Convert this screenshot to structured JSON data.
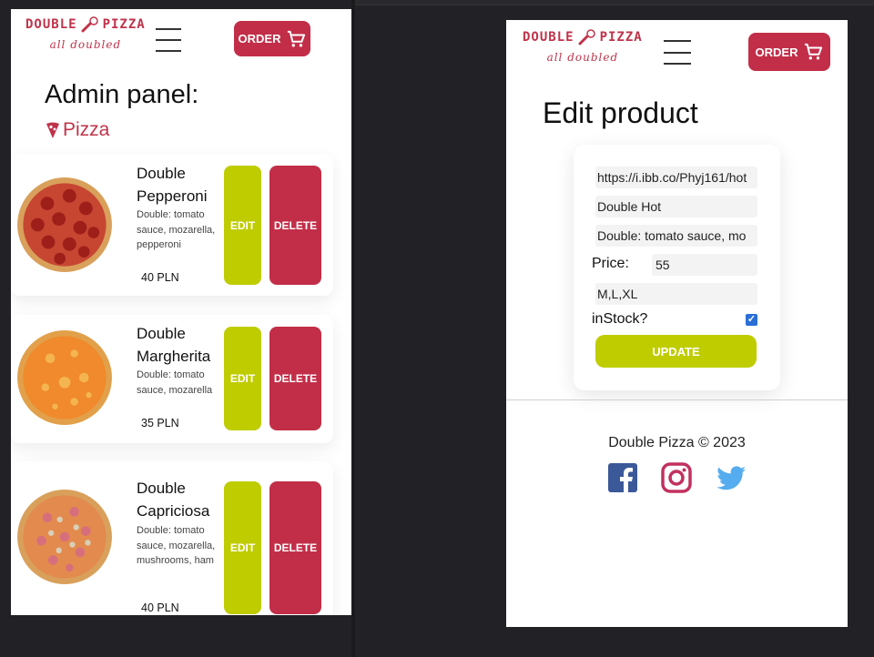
{
  "brand": {
    "name_left": "DOUBLE",
    "name_right": "PIZZA",
    "tagline": "all doubled",
    "accent": "#c0334a",
    "lime": "#bfcc00"
  },
  "header": {
    "order_label": "ORDER",
    "cart_icon": "cart-icon",
    "menu_icon": "hamburger-menu-icon"
  },
  "admin": {
    "title": "Admin panel:",
    "category": "Pizza",
    "products": [
      {
        "name": "Double Pepperoni",
        "description": "Double: tomato sauce, mozarella, pepperoni",
        "price": "40 PLN",
        "edit_label": "EDIT",
        "delete_label": "DELETE"
      },
      {
        "name": "Double Margherita",
        "description": "Double: tomato sauce, mozarella",
        "price": "35 PLN",
        "edit_label": "EDIT",
        "delete_label": "DELETE"
      },
      {
        "name": "Double Capriciosa",
        "description": "Double: tomato sauce, mozarella, mushrooms, ham",
        "price": "40 PLN",
        "edit_label": "EDIT",
        "delete_label": "DELETE"
      }
    ]
  },
  "edit": {
    "title": "Edit product",
    "image_url": "https://i.ibb.co/Phyj161/hot",
    "name": "Double Hot",
    "description": "Double: tomato sauce, mo",
    "price_label": "Price:",
    "price_value": "55",
    "sizes": "M,L,XL",
    "instock_label": "inStock?",
    "instock_checked": true,
    "update_label": "UPDATE"
  },
  "footer": {
    "copyright": "Double Pizza © 2023",
    "social": [
      "facebook-icon",
      "instagram-icon",
      "twitter-icon"
    ]
  }
}
